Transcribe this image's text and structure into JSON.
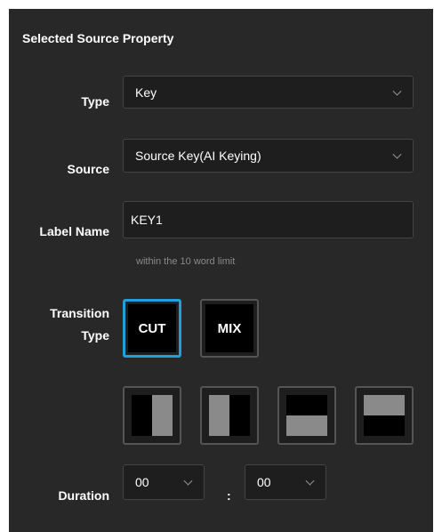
{
  "panel": {
    "title": "Selected Source Property"
  },
  "type_field": {
    "label": "Type",
    "value": "Key"
  },
  "source_field": {
    "label": "Source",
    "value": "Source Key(AI Keying)"
  },
  "label_name_field": {
    "label": "Label Name",
    "value": "KEY1",
    "hint": "within the 10 word limit"
  },
  "transition": {
    "label_line1": "Transition",
    "label_line2": "Type",
    "buttons": [
      {
        "label": "CUT",
        "selected": true
      },
      {
        "label": "MIX",
        "selected": false
      }
    ],
    "wipe_icons": [
      "wipe-right-icon",
      "wipe-left-icon",
      "wipe-down-icon",
      "wipe-up-icon"
    ]
  },
  "duration": {
    "label": "Duration",
    "first_value": "00",
    "separator": ":",
    "second_value": "00"
  },
  "colors": {
    "panel_background": "#282828",
    "accent_selected": "#1ea0dc",
    "hint_text": "#8a8a8a"
  }
}
